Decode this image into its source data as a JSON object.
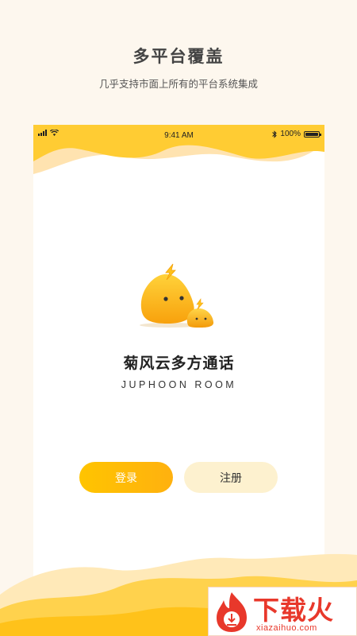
{
  "header": {
    "title": "多平台覆盖",
    "subtitle": "几乎支持市面上所有的平台系统集成"
  },
  "status_bar": {
    "time": "9:41 AM",
    "battery": "100%",
    "battery_level": 1.0,
    "icons": [
      "signal-icon",
      "wifi-icon",
      "bluetooth-icon",
      "battery-icon"
    ]
  },
  "app": {
    "name": "菊风云多方通话",
    "subtitle": "JUPHOON ROOM",
    "mascot_icon": "mascot-icon"
  },
  "buttons": {
    "login": "登录",
    "register": "注册"
  },
  "watermark": {
    "title": "下载火",
    "url": "xiazaihuo.com"
  },
  "colors": {
    "background": "#fdf7ee",
    "accent": "#ffc400",
    "register_bg": "#fdf1cf",
    "watermark": "#e8382b"
  }
}
